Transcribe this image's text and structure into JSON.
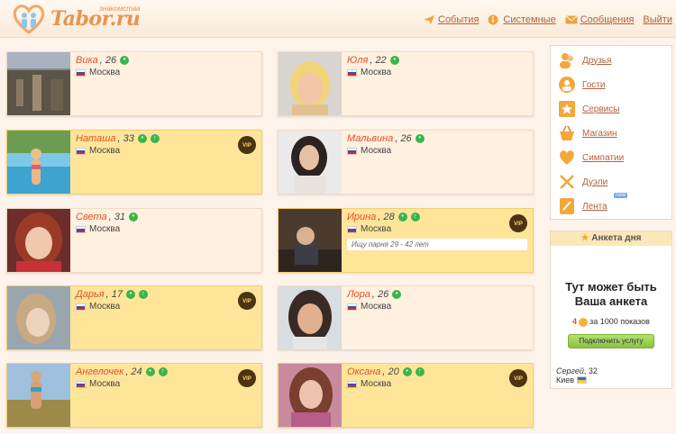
{
  "header": {
    "logo_text": "Tabor.ru",
    "logo_sub": "знакомства",
    "nav": [
      {
        "label": "События",
        "icon": "paper-plane-icon"
      },
      {
        "label": "Системные",
        "icon": "info-icon"
      },
      {
        "label": "Сообщения",
        "icon": "envelope-icon"
      },
      {
        "label": "Выйти",
        "icon": ""
      }
    ]
  },
  "profiles": [
    {
      "name": "Вика",
      "age": ", 26",
      "city": "Москва",
      "vip": false,
      "up": false
    },
    {
      "name": "Юля",
      "age": ", 22",
      "city": "Москва",
      "vip": false,
      "up": false
    },
    {
      "name": "Наташа",
      "age": ", 33",
      "city": "Москва",
      "vip": true,
      "up": true
    },
    {
      "name": "Мальвина",
      "age": ", 26",
      "city": "Москва",
      "vip": false,
      "up": false
    },
    {
      "name": "Света",
      "age": ", 31",
      "city": "Москва",
      "vip": false,
      "up": false
    },
    {
      "name": "Ирина",
      "age": ", 28",
      "city": "Москва",
      "vip": true,
      "up": true,
      "status": "Ищу парня 29 - 42 лет"
    },
    {
      "name": "Дарья",
      "age": ", 17",
      "city": "Москва",
      "vip": true,
      "up": true
    },
    {
      "name": "Лора",
      "age": ", 26",
      "city": "Москва",
      "vip": false,
      "up": false
    },
    {
      "name": "Ангелочек",
      "age": ", 24",
      "city": "Москва",
      "vip": true,
      "up": true
    },
    {
      "name": "Оксана",
      "age": ", 20",
      "city": "Москва",
      "vip": true,
      "up": true
    }
  ],
  "vip_label": "VIP",
  "sidebar": {
    "items": [
      {
        "label": "Друзья",
        "icon": "friends-icon"
      },
      {
        "label": "Гости",
        "icon": "guests-icon"
      },
      {
        "label": "Сервисы",
        "icon": "star-icon"
      },
      {
        "label": "Магазин",
        "icon": "basket-icon"
      },
      {
        "label": "Симпатии",
        "icon": "heart-icon"
      },
      {
        "label": "Дуэли",
        "icon": "swords-icon"
      },
      {
        "label": "Лента",
        "icon": "feed-icon"
      }
    ],
    "new_label": "new"
  },
  "profile_of_day": {
    "title": "Анкета дня",
    "promo_line1": "Тут может быть",
    "promo_line2": "Ваша анкета",
    "price": "4",
    "price_text": "за 1000 показов",
    "button": "Подключить услугу",
    "user_name": "Сергей",
    "user_age": ", 32",
    "user_city": "Киев"
  },
  "colors": {
    "accent": "#e8954f",
    "link": "#b5603a",
    "vip_bg": "#ffe59a",
    "card_bg": "#fff0e0"
  }
}
